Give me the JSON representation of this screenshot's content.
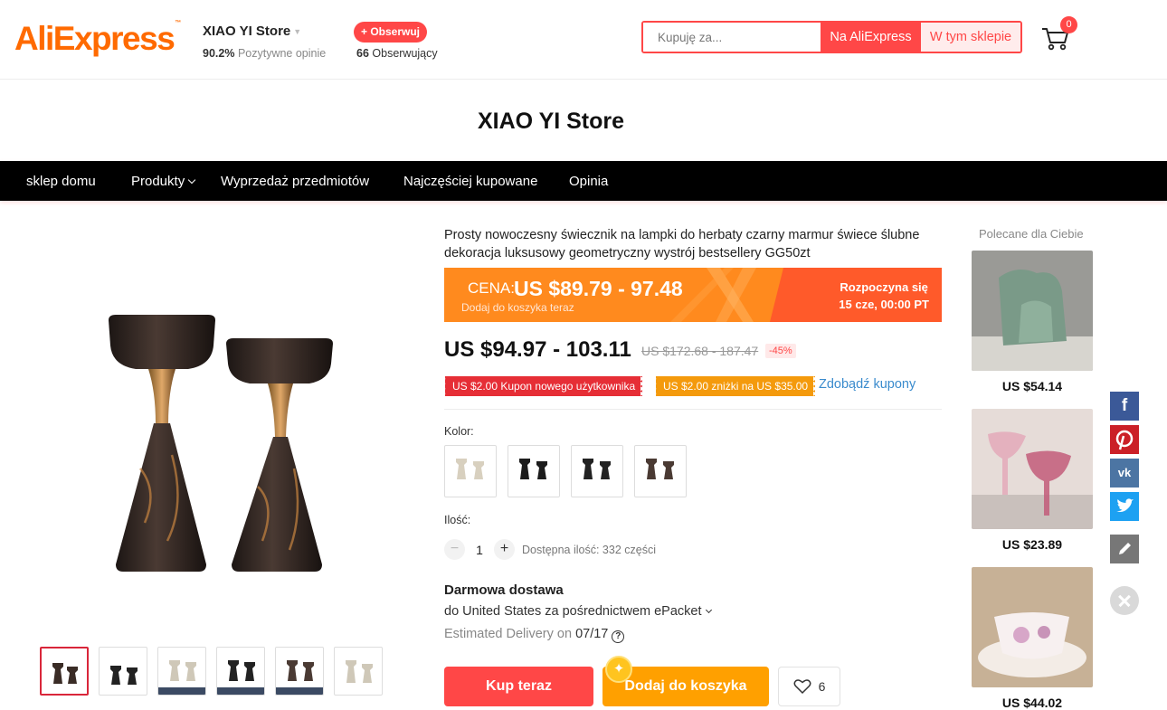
{
  "header": {
    "logo_text": "AliExpress",
    "logo_tm": "™",
    "store_name": "XIAO YI Store",
    "rating_value": "90.2%",
    "rating_label": "Pozytywne opinie",
    "follow_label": "+ Obserwuj",
    "followers_count": "66",
    "followers_label": "Obserwujący",
    "search_placeholder": "Kupuję za...",
    "search_ali_label": "Na AliExpress",
    "search_store_label": "W tym sklepie",
    "cart_count": "0"
  },
  "store": {
    "title": "XIAO YI Store",
    "nav": [
      "sklep domu",
      "Produkty",
      "Wyprzedaż przedmiotów",
      "Najczęściej kupowane",
      "Opinia"
    ]
  },
  "product": {
    "title": "Prosty nowoczesny świecznik na lampki do herbaty czarny marmur świece ślubne dekoracja luksusowy geometryczny wystrój bestsellery GG50zt",
    "banner": {
      "cena_label": "CENA:",
      "price": "US $89.79 - 97.48",
      "sub": "Dodaj do koszyka teraz",
      "start_line1": "Rozpoczyna się",
      "start_line2": "15 cze, 00:00 PT"
    },
    "current_price": "US $94.97 - 103.11",
    "old_price": "US $172.68 - 187.47",
    "discount": "-45%",
    "coupons": [
      "US $2.00 Kupon nowego użytkownika",
      "US $2.00 zniżki na US $35.00"
    ],
    "get_coupons": "Zdobądź kupony",
    "color_label": "Kolor:",
    "qty_label": "Ilość:",
    "qty_minus": "−",
    "qty_value": "1",
    "qty_plus": "+",
    "qty_available": "Dostępna ilość: 332 części",
    "shipping_title": "Darmowa dostawa",
    "shipping_to": "do United States za pośrednictwem ePacket",
    "eta_label": "Estimated Delivery on",
    "eta_date": "07/17",
    "help": "?",
    "buy_label": "Kup teraz",
    "cart_label": "Dodaj do koszyka",
    "wish_count": "6"
  },
  "recommended": {
    "title": "Polecane dla Ciebie",
    "prices": [
      "US $54.14",
      "US $23.89",
      "US $44.02"
    ]
  },
  "share": {
    "facebook": "f",
    "vk": "vk"
  },
  "colors": {
    "accent": "#ff4747",
    "brand": "#ff6a00",
    "coupon_orange": "#f49a0c",
    "link": "#3a8bcd"
  }
}
